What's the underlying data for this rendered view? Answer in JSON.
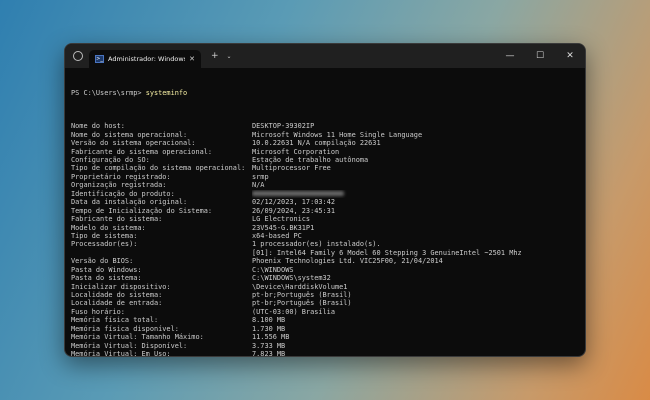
{
  "window": {
    "tab_title": "Administrador: Windows Pow",
    "tab_icon_glyph": ">_",
    "new_tab": "+",
    "dropdown": "⌄",
    "minimize": "—",
    "maximize": "☐",
    "close": "✕",
    "tab_close": "✕"
  },
  "console": {
    "prompt": "PS C:\\Users\\srmp>",
    "command": "systeminfo",
    "rows": [
      {
        "label": "Nome do host:",
        "value": "DESKTOP-39302IP"
      },
      {
        "label": "Nome do sistema operacional:",
        "value": "Microsoft Windows 11 Home Single Language"
      },
      {
        "label": "Versão do sistema operacional:",
        "value": "10.0.22631 N/A compilação 22631"
      },
      {
        "label": "Fabricante do sistema operacional:",
        "value": "Microsoft Corporation"
      },
      {
        "label": "Configuração do SO:",
        "value": "Estação de trabalho autônoma"
      },
      {
        "label": "Tipo de compilação do sistema operacional:",
        "value": "Multiprocessor Free"
      },
      {
        "label": "Proprietário registrado:",
        "value": "srmp"
      },
      {
        "label": "Organização registrada:",
        "value": "N/A"
      },
      {
        "label": "Identificação do produto:",
        "value": ""
      },
      {
        "label": "Data da instalação original:",
        "value": "02/12/2023, 17:03:42"
      },
      {
        "label": "Tempo de Inicialização do Sistema:",
        "value": "26/09/2024, 23:45:31"
      },
      {
        "label": "Fabricante do sistema:",
        "value": "LG Electronics"
      },
      {
        "label": "Modelo do sistema:",
        "value": "23V545-G.BK31P1"
      },
      {
        "label": "Tipo de sistema:",
        "value": "x64-based PC"
      },
      {
        "label": "Processador(es):",
        "value": "1 processador(es) instalado(s)."
      },
      {
        "label": "",
        "value": "[01]: Intel64 Family 6 Model 60 Stepping 3 GenuineIntel ~2501 Mhz"
      },
      {
        "label": "Versão do BIOS:",
        "value": "Phoenix Technologies Ltd. VIC25F00, 21/04/2014"
      },
      {
        "label": "Pasta do Windows:",
        "value": "C:\\WINDOWS"
      },
      {
        "label": "Pasta do sistema:",
        "value": "C:\\WINDOWS\\system32"
      },
      {
        "label": "Inicializar dispositivo:",
        "value": "\\Device\\HarddiskVolume1"
      },
      {
        "label": "Localidade do sistema:",
        "value": "pt-br;Português (Brasil)"
      },
      {
        "label": "Localidade de entrada:",
        "value": "pt-br;Português (Brasil)"
      },
      {
        "label": "Fuso horário:",
        "value": "(UTC-03:00) Brasília"
      },
      {
        "label": "Memória física total:",
        "value": "8.100 MB"
      },
      {
        "label": "Memória física disponível:",
        "value": "1.730 MB"
      },
      {
        "label": "Memória Virtual: Tamanho Máximo:",
        "value": "11.556 MB"
      },
      {
        "label": "Memória Virtual: Disponível:",
        "value": "3.733 MB"
      },
      {
        "label": "Memória Virtual: Em Uso:",
        "value": "7.823 MB"
      },
      {
        "label": "Local(is) de arquivo de paginação:",
        "value": "C:\\pagefile.sys"
      },
      {
        "label": "Domínio:",
        "value": "WORKGROUP"
      }
    ]
  }
}
